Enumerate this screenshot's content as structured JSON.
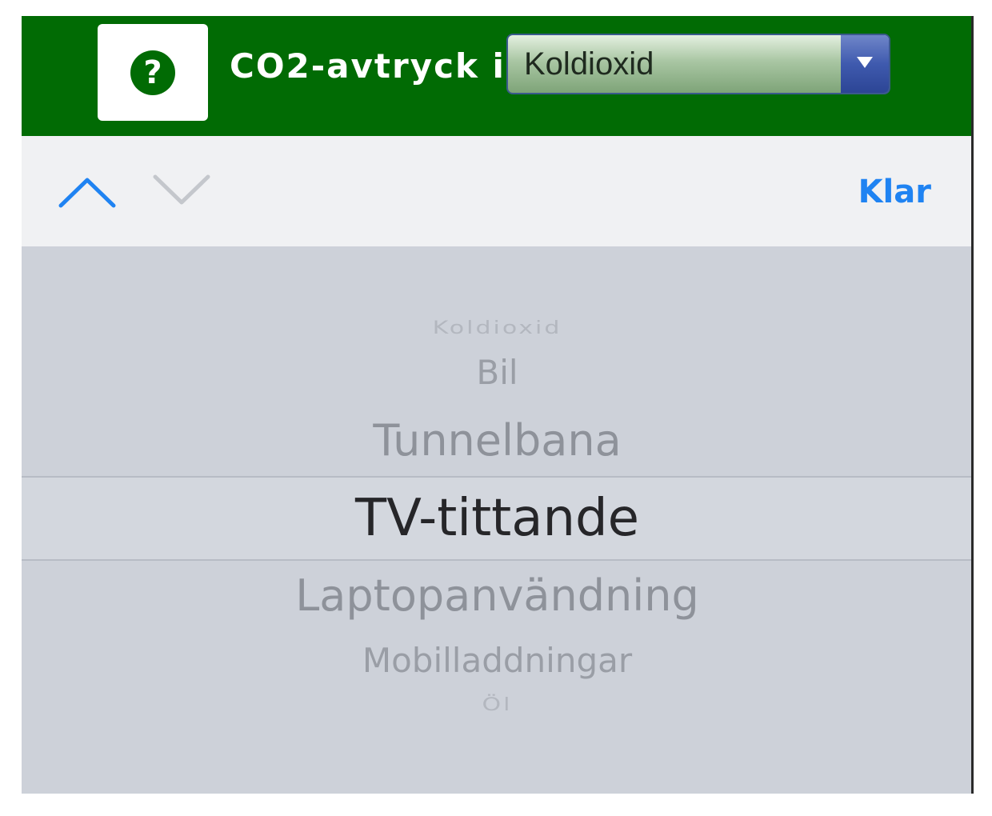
{
  "header": {
    "help_icon_glyph": "?",
    "title": "CO2-avtryck i",
    "select": {
      "value": "Koldioxid"
    },
    "background_color": "#016b04"
  },
  "toolbar": {
    "done_label": "Klar",
    "accent_color": "#1f83f2"
  },
  "picker": {
    "options": [
      "Koldioxid",
      "Bil",
      "Tunnelbana",
      "TV-tittande",
      "Laptopanvändning",
      "Mobilladdningar",
      "Öl"
    ],
    "selected": "TV-tittande"
  },
  "icons": {
    "help": "question-circle-icon",
    "up": "chevron-up-icon",
    "down": "chevron-down-icon",
    "select_arrow": "triangle-down-icon"
  }
}
